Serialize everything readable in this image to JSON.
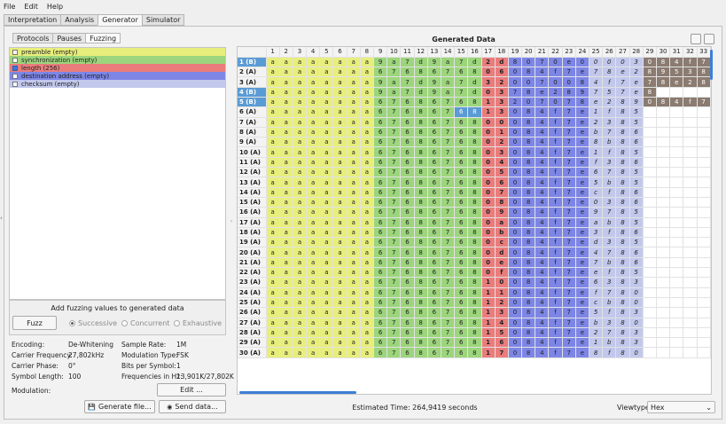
{
  "menu": [
    "File",
    "Edit",
    "Help"
  ],
  "tabs": [
    "Interpretation",
    "Analysis",
    "Generator",
    "Simulator"
  ],
  "subtabs": [
    "Protocols",
    "Pauses",
    "Fuzzing"
  ],
  "labels": [
    {
      "text": "preamble (empty)",
      "color": "#e8ee7b",
      "checked": false
    },
    {
      "text": "synchronization (empty)",
      "color": "#9cd57c",
      "checked": false
    },
    {
      "text": "length (256)",
      "color": "#ea7c7c",
      "checked": true
    },
    {
      "text": "destination address (empty)",
      "color": "#7d86e6",
      "checked": false
    },
    {
      "text": "checksum (empty)",
      "color": "#c2c8ec",
      "checked": false
    }
  ],
  "fuzzing": {
    "title": "Add fuzzing values to generated data",
    "button": "Fuzz",
    "modes": [
      "Successive",
      "Concurrent",
      "Exhaustive"
    ],
    "selected": "Successive"
  },
  "info": {
    "encoding_label": "Encoding:",
    "encoding": "De-Whitening",
    "sample_rate_label": "Sample Rate:",
    "sample_rate": "1M",
    "carrier_freq_label": "Carrier Frequency:",
    "carrier_freq": "27,802kHz",
    "modulation_type_label": "Modulation Type:",
    "modulation_type": "FSK",
    "carrier_phase_label": "Carrier Phase:",
    "carrier_phase": "0°",
    "bits_per_symbol_label": "Bits per Symbol:",
    "bits_per_symbol": "1",
    "symbol_length_label": "Symbol Length:",
    "symbol_length": "100",
    "frequencies_label": "Frequencies in Hz:",
    "frequencies": "13,901K/27,802K",
    "modulation_label": "Modulation:"
  },
  "buttons": {
    "edit": "Edit ...",
    "generate": "Generate file...",
    "send": "Send data..."
  },
  "generated": {
    "title": "Generated Data",
    "estimated_time": "Estimated Time: 264,9419 seconds",
    "viewtype_label": "Viewtype:",
    "viewtype": "Hex"
  },
  "columns": [
    "1",
    "2",
    "3",
    "4",
    "5",
    "6",
    "7",
    "8",
    "9",
    "10",
    "11",
    "12",
    "13",
    "14",
    "15",
    "16",
    "17",
    "18",
    "19",
    "20",
    "21",
    "22",
    "23",
    "24",
    "25",
    "26",
    "27",
    "28",
    "29",
    "30",
    "31",
    "32",
    "33"
  ],
  "rows": [
    {
      "h": "1 (B)",
      "c": [
        "a",
        "a",
        "a",
        "a",
        "a",
        "a",
        "a",
        "a",
        "9",
        "a",
        "7",
        "d",
        "9",
        "a",
        "7",
        "d",
        "2",
        "d",
        "8",
        "0",
        "7",
        "0",
        "e",
        "0",
        "0",
        "0",
        "0",
        "3",
        "0",
        "8",
        "4",
        "f",
        "7"
      ]
    },
    {
      "h": "2 (A)",
      "c": [
        "a",
        "a",
        "a",
        "a",
        "a",
        "a",
        "a",
        "a",
        "6",
        "7",
        "6",
        "8",
        "6",
        "7",
        "6",
        "8",
        "0",
        "6",
        "0",
        "8",
        "4",
        "f",
        "7",
        "e",
        "7",
        "8",
        "e",
        "2",
        "8",
        "9",
        "5",
        "3",
        "8"
      ]
    },
    {
      "h": "3 (A)",
      "c": [
        "a",
        "a",
        "a",
        "a",
        "a",
        "a",
        "a",
        "a",
        "9",
        "a",
        "7",
        "d",
        "9",
        "a",
        "7",
        "d",
        "3",
        "2",
        "0",
        "0",
        "7",
        "0",
        "0",
        "8",
        "4",
        "f",
        "7",
        "e",
        "7",
        "8",
        "e",
        "2",
        "8"
      ]
    },
    {
      "h": "4 (B)",
      "c": [
        "a",
        "a",
        "a",
        "a",
        "a",
        "a",
        "a",
        "a",
        "9",
        "a",
        "7",
        "d",
        "9",
        "a",
        "7",
        "d",
        "0",
        "3",
        "7",
        "8",
        "e",
        "2",
        "8",
        "9",
        "7",
        "5",
        "7",
        "e",
        "8",
        "",
        "",
        "",
        ""
      ]
    },
    {
      "h": "5 (B)",
      "c": [
        "a",
        "a",
        "a",
        "a",
        "a",
        "a",
        "a",
        "a",
        "6",
        "7",
        "6",
        "8",
        "6",
        "7",
        "6",
        "8",
        "1",
        "3",
        "2",
        "0",
        "7",
        "0",
        "7",
        "8",
        "e",
        "2",
        "8",
        "9",
        "0",
        "8",
        "4",
        "f",
        "7"
      ]
    },
    {
      "h": "6 (A)",
      "c": [
        "a",
        "a",
        "a",
        "a",
        "a",
        "a",
        "a",
        "a",
        "6",
        "7",
        "6",
        "8",
        "6",
        "7",
        "6",
        "8",
        "1",
        "3",
        "0",
        "8",
        "4",
        "f",
        "7",
        "e",
        "1",
        "f",
        "8",
        "5",
        "",
        "",
        "",
        "",
        ""
      ]
    },
    {
      "h": "7 (A)",
      "c": [
        "a",
        "a",
        "a",
        "a",
        "a",
        "a",
        "a",
        "a",
        "6",
        "7",
        "6",
        "8",
        "6",
        "7",
        "6",
        "8",
        "0",
        "0",
        "0",
        "8",
        "4",
        "f",
        "7",
        "e",
        "2",
        "3",
        "8",
        "5",
        "",
        "",
        "",
        "",
        ""
      ]
    },
    {
      "h": "8 (A)",
      "c": [
        "a",
        "a",
        "a",
        "a",
        "a",
        "a",
        "a",
        "a",
        "6",
        "7",
        "6",
        "8",
        "6",
        "7",
        "6",
        "8",
        "0",
        "1",
        "0",
        "8",
        "4",
        "f",
        "7",
        "e",
        "b",
        "7",
        "8",
        "6",
        "",
        "",
        "",
        "",
        ""
      ]
    },
    {
      "h": "9 (A)",
      "c": [
        "a",
        "a",
        "a",
        "a",
        "a",
        "a",
        "a",
        "a",
        "6",
        "7",
        "6",
        "8",
        "6",
        "7",
        "6",
        "8",
        "0",
        "2",
        "0",
        "8",
        "4",
        "f",
        "7",
        "e",
        "8",
        "b",
        "8",
        "6",
        "",
        "",
        "",
        "",
        ""
      ]
    },
    {
      "h": "10 (A)",
      "c": [
        "a",
        "a",
        "a",
        "a",
        "a",
        "a",
        "a",
        "a",
        "6",
        "7",
        "6",
        "8",
        "6",
        "7",
        "6",
        "8",
        "0",
        "3",
        "0",
        "8",
        "4",
        "f",
        "7",
        "e",
        "1",
        "f",
        "8",
        "5",
        "",
        "",
        "",
        "",
        ""
      ]
    },
    {
      "h": "11 (A)",
      "c": [
        "a",
        "a",
        "a",
        "a",
        "a",
        "a",
        "a",
        "a",
        "6",
        "7",
        "6",
        "8",
        "6",
        "7",
        "6",
        "8",
        "0",
        "4",
        "0",
        "8",
        "4",
        "f",
        "7",
        "e",
        "f",
        "3",
        "8",
        "6",
        "",
        "",
        "",
        "",
        ""
      ]
    },
    {
      "h": "12 (A)",
      "c": [
        "a",
        "a",
        "a",
        "a",
        "a",
        "a",
        "a",
        "a",
        "6",
        "7",
        "6",
        "8",
        "6",
        "7",
        "6",
        "8",
        "0",
        "5",
        "0",
        "8",
        "4",
        "f",
        "7",
        "e",
        "6",
        "7",
        "8",
        "5",
        "",
        "",
        "",
        "",
        ""
      ]
    },
    {
      "h": "13 (A)",
      "c": [
        "a",
        "a",
        "a",
        "a",
        "a",
        "a",
        "a",
        "a",
        "6",
        "7",
        "6",
        "8",
        "6",
        "7",
        "6",
        "8",
        "0",
        "6",
        "0",
        "8",
        "4",
        "f",
        "7",
        "e",
        "5",
        "b",
        "8",
        "5",
        "",
        "",
        "",
        "",
        ""
      ]
    },
    {
      "h": "14 (A)",
      "c": [
        "a",
        "a",
        "a",
        "a",
        "a",
        "a",
        "a",
        "a",
        "6",
        "7",
        "6",
        "8",
        "6",
        "7",
        "6",
        "8",
        "0",
        "7",
        "0",
        "8",
        "4",
        "f",
        "7",
        "e",
        "c",
        "f",
        "8",
        "6",
        "",
        "",
        "",
        "",
        ""
      ]
    },
    {
      "h": "15 (A)",
      "c": [
        "a",
        "a",
        "a",
        "a",
        "a",
        "a",
        "a",
        "a",
        "6",
        "7",
        "6",
        "8",
        "6",
        "7",
        "6",
        "8",
        "0",
        "8",
        "0",
        "8",
        "4",
        "f",
        "7",
        "e",
        "0",
        "3",
        "8",
        "6",
        "",
        "",
        "",
        "",
        ""
      ]
    },
    {
      "h": "16 (A)",
      "c": [
        "a",
        "a",
        "a",
        "a",
        "a",
        "a",
        "a",
        "a",
        "6",
        "7",
        "6",
        "8",
        "6",
        "7",
        "6",
        "8",
        "0",
        "9",
        "0",
        "8",
        "4",
        "f",
        "7",
        "e",
        "9",
        "7",
        "8",
        "5",
        "",
        "",
        "",
        "",
        ""
      ]
    },
    {
      "h": "17 (A)",
      "c": [
        "a",
        "a",
        "a",
        "a",
        "a",
        "a",
        "a",
        "a",
        "6",
        "7",
        "6",
        "8",
        "6",
        "7",
        "6",
        "8",
        "0",
        "a",
        "0",
        "8",
        "4",
        "f",
        "7",
        "e",
        "a",
        "b",
        "8",
        "5",
        "",
        "",
        "",
        "",
        ""
      ]
    },
    {
      "h": "18 (A)",
      "c": [
        "a",
        "a",
        "a",
        "a",
        "a",
        "a",
        "a",
        "a",
        "6",
        "7",
        "6",
        "8",
        "6",
        "7",
        "6",
        "8",
        "0",
        "b",
        "0",
        "8",
        "4",
        "f",
        "7",
        "e",
        "3",
        "f",
        "8",
        "6",
        "",
        "",
        "",
        "",
        ""
      ]
    },
    {
      "h": "19 (A)",
      "c": [
        "a",
        "a",
        "a",
        "a",
        "a",
        "a",
        "a",
        "a",
        "6",
        "7",
        "6",
        "8",
        "6",
        "7",
        "6",
        "8",
        "0",
        "c",
        "0",
        "8",
        "4",
        "f",
        "7",
        "e",
        "d",
        "3",
        "8",
        "5",
        "",
        "",
        "",
        "",
        ""
      ]
    },
    {
      "h": "20 (A)",
      "c": [
        "a",
        "a",
        "a",
        "a",
        "a",
        "a",
        "a",
        "a",
        "6",
        "7",
        "6",
        "8",
        "6",
        "7",
        "6",
        "8",
        "0",
        "d",
        "0",
        "8",
        "4",
        "f",
        "7",
        "e",
        "4",
        "7",
        "8",
        "6",
        "",
        "",
        "",
        "",
        ""
      ]
    },
    {
      "h": "21 (A)",
      "c": [
        "a",
        "a",
        "a",
        "a",
        "a",
        "a",
        "a",
        "a",
        "6",
        "7",
        "6",
        "8",
        "6",
        "7",
        "6",
        "8",
        "0",
        "e",
        "0",
        "8",
        "4",
        "f",
        "7",
        "e",
        "7",
        "b",
        "8",
        "6",
        "",
        "",
        "",
        "",
        ""
      ]
    },
    {
      "h": "22 (A)",
      "c": [
        "a",
        "a",
        "a",
        "a",
        "a",
        "a",
        "a",
        "a",
        "6",
        "7",
        "6",
        "8",
        "6",
        "7",
        "6",
        "8",
        "0",
        "f",
        "0",
        "8",
        "4",
        "f",
        "7",
        "e",
        "e",
        "f",
        "8",
        "5",
        "",
        "",
        "",
        "",
        ""
      ]
    },
    {
      "h": "23 (A)",
      "c": [
        "a",
        "a",
        "a",
        "a",
        "a",
        "a",
        "a",
        "a",
        "6",
        "7",
        "6",
        "8",
        "6",
        "7",
        "6",
        "8",
        "1",
        "0",
        "0",
        "8",
        "4",
        "f",
        "7",
        "e",
        "6",
        "3",
        "8",
        "3",
        "",
        "",
        "",
        "",
        ""
      ]
    },
    {
      "h": "24 (A)",
      "c": [
        "a",
        "a",
        "a",
        "a",
        "a",
        "a",
        "a",
        "a",
        "6",
        "7",
        "6",
        "8",
        "6",
        "7",
        "6",
        "8",
        "1",
        "1",
        "0",
        "8",
        "4",
        "f",
        "7",
        "e",
        "f",
        "7",
        "8",
        "0",
        "",
        "",
        "",
        "",
        ""
      ]
    },
    {
      "h": "25 (A)",
      "c": [
        "a",
        "a",
        "a",
        "a",
        "a",
        "a",
        "a",
        "a",
        "6",
        "7",
        "6",
        "8",
        "6",
        "7",
        "6",
        "8",
        "1",
        "2",
        "0",
        "8",
        "4",
        "f",
        "7",
        "e",
        "c",
        "b",
        "8",
        "0",
        "",
        "",
        "",
        "",
        ""
      ]
    },
    {
      "h": "26 (A)",
      "c": [
        "a",
        "a",
        "a",
        "a",
        "a",
        "a",
        "a",
        "a",
        "6",
        "7",
        "6",
        "8",
        "6",
        "7",
        "6",
        "8",
        "1",
        "3",
        "0",
        "8",
        "4",
        "f",
        "7",
        "e",
        "5",
        "f",
        "8",
        "3",
        "",
        "",
        "",
        "",
        ""
      ]
    },
    {
      "h": "27 (A)",
      "c": [
        "a",
        "a",
        "a",
        "a",
        "a",
        "a",
        "a",
        "a",
        "6",
        "7",
        "6",
        "8",
        "6",
        "7",
        "6",
        "8",
        "1",
        "4",
        "0",
        "8",
        "4",
        "f",
        "7",
        "e",
        "b",
        "3",
        "8",
        "0",
        "",
        "",
        "",
        "",
        ""
      ]
    },
    {
      "h": "28 (A)",
      "c": [
        "a",
        "a",
        "a",
        "a",
        "a",
        "a",
        "a",
        "a",
        "6",
        "7",
        "6",
        "8",
        "6",
        "7",
        "6",
        "8",
        "1",
        "5",
        "0",
        "8",
        "4",
        "f",
        "7",
        "e",
        "2",
        "7",
        "8",
        "3",
        "",
        "",
        "",
        "",
        ""
      ]
    },
    {
      "h": "29 (A)",
      "c": [
        "a",
        "a",
        "a",
        "a",
        "a",
        "a",
        "a",
        "a",
        "6",
        "7",
        "6",
        "8",
        "6",
        "7",
        "6",
        "8",
        "1",
        "6",
        "0",
        "8",
        "4",
        "f",
        "7",
        "e",
        "1",
        "b",
        "8",
        "3",
        "",
        "",
        "",
        "",
        ""
      ]
    },
    {
      "h": "30 (A)",
      "c": [
        "a",
        "a",
        "a",
        "a",
        "a",
        "a",
        "a",
        "a",
        "6",
        "7",
        "6",
        "8",
        "6",
        "7",
        "6",
        "8",
        "1",
        "7",
        "0",
        "8",
        "4",
        "f",
        "7",
        "e",
        "8",
        "f",
        "8",
        "0",
        "",
        "",
        "",
        "",
        ""
      ]
    }
  ]
}
